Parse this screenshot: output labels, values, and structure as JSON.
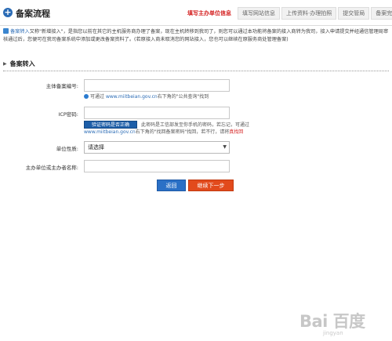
{
  "header": {
    "icon": "plus-circle-icon",
    "title": "备案流程",
    "steps": [
      {
        "label": "填写主办单位信息",
        "active": true
      },
      {
        "label": "填写网站信息",
        "active": false
      },
      {
        "label": "上传资料·办理拍照",
        "active": false
      },
      {
        "label": "提交管局",
        "active": false
      },
      {
        "label": "备案完成",
        "active": false
      }
    ]
  },
  "intro": {
    "lead": "备案转入",
    "text": "又称\"新增接入\"，是指您以前在其它的主机服务商办理了备案，现在主机转移到我司了，则您可以通过本功能将备案的接入商转为我司，接入申请提交并经通信管理局审核通过后，您便可在我司备案系统中添加或更改备案资料了。(若原接入商未取消您的网站接入，您也可以继续在原服务商处管理备案)"
  },
  "section": {
    "title": "备案转入"
  },
  "form": {
    "record_no_label": "主体备案编号:",
    "record_no_value": "",
    "record_no_hint_prefix": "可通过",
    "record_no_hint_link": "www.miitbeian.gov.cn",
    "record_no_hint_suffix": "右下角的\"公共查询\"找到",
    "icp_password_label": "ICP密码:",
    "icp_password_value": "",
    "verify_button": "验证密码是否正确",
    "icp_hint_1": "此密码是工信部发至你手机的密码，若忘记，可通过",
    "icp_hint_link": "www.miitbeian.gov.cn",
    "icp_hint_2": "右下角的\"找回备案密码\"找回，若不行，请将",
    "icp_hint_red": "真找回",
    "unit_type_label": "单位性质:",
    "unit_type_value": "请选择",
    "owner_name_label": "主办单位或主办者名称:",
    "owner_name_value": ""
  },
  "buttons": {
    "back": "返回",
    "next": "继续下一步"
  },
  "watermark": {
    "main": "Bai 百度",
    "sub": "jingyan"
  }
}
